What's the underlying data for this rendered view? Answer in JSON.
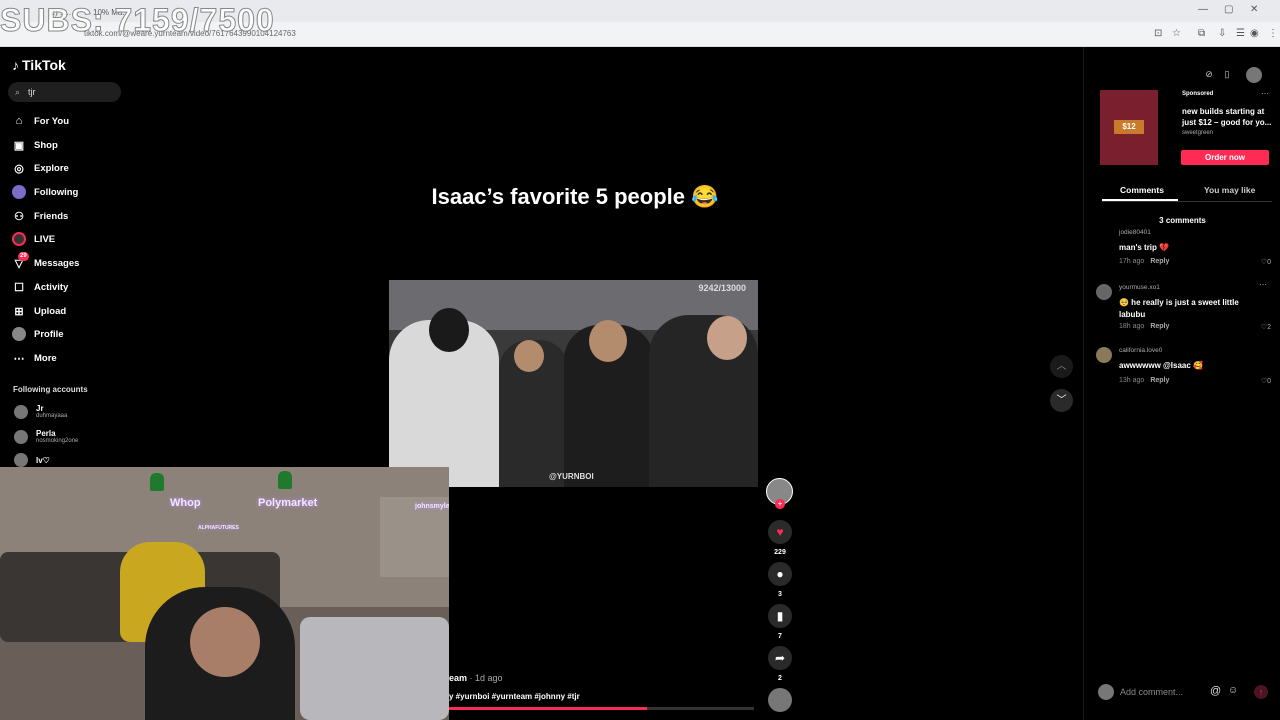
{
  "browser": {
    "tabs": [
      "(2) 1...",
      "10% Ma..."
    ],
    "url": "tiktok.com/@weare.yurnteam/video/7617643990104124763",
    "window_controls": [
      "—",
      "▢",
      "✕"
    ]
  },
  "overlay": {
    "subs_text": "SUBS: 7159/7500"
  },
  "sidebar": {
    "logo": "TikTok",
    "search_value": "tjr",
    "nav": [
      {
        "label": "For You",
        "icon": "home-icon"
      },
      {
        "label": "Shop",
        "icon": "shop-icon"
      },
      {
        "label": "Explore",
        "icon": "compass-icon"
      },
      {
        "label": "Following",
        "icon": "following-icon"
      },
      {
        "label": "Friends",
        "icon": "friends-icon"
      },
      {
        "label": "LIVE",
        "icon": "live-icon"
      },
      {
        "label": "Messages",
        "icon": "messages-icon",
        "badge": "29"
      },
      {
        "label": "Activity",
        "icon": "activity-icon"
      },
      {
        "label": "Upload",
        "icon": "upload-icon"
      },
      {
        "label": "Profile",
        "icon": "profile-icon"
      },
      {
        "label": "More",
        "icon": "more-icon"
      }
    ],
    "following_title": "Following accounts",
    "accounts": [
      {
        "name": "Jr",
        "username": "duhmayaaa"
      },
      {
        "name": "Perla",
        "username": "nosmoking2one"
      },
      {
        "name": "lv♡",
        "username": ""
      }
    ]
  },
  "video": {
    "title": "Isaac’s favorite 5 people 😂",
    "counter": "9242/13000",
    "watermark": "@YURNBOI",
    "author": "eam",
    "date": "· 1d ago",
    "tags": "y #yurnboi #yurnteam #johnny #tjr",
    "progress_fraction": 0.65
  },
  "actions": {
    "likes": "229",
    "comments": "3",
    "saves": "7",
    "shares": "2"
  },
  "ad": {
    "sponsored": "Sponsored",
    "text": "new builds starting at just $12 – good for yo...",
    "brand": "sweetgreen",
    "price": "$12",
    "cta": "Order now"
  },
  "panel": {
    "tabs": [
      "Comments",
      "You may like"
    ],
    "comment_count": "3 comments",
    "reply_label": "Reply"
  },
  "comments": [
    {
      "user": "jodie80401",
      "text": "man's trip 💔",
      "time": "17h ago",
      "likes": "0"
    },
    {
      "user": "yourmuse.xo1",
      "text": "🥺 he really is just a sweet little labubu",
      "time": "18h ago",
      "likes": "2"
    },
    {
      "user": "california.love0",
      "text": "awwwwww @Isaac 🥰",
      "time": "13h ago",
      "likes": "0"
    }
  ],
  "comment_bar": {
    "placeholder": "Add comment..."
  },
  "webcam": {
    "neon_left": "Whop",
    "neon_right": "Polymarket",
    "neon_center": "ALPHAFUTURES",
    "neon_side": "johnsmyle"
  },
  "colors": {
    "accent": "#fe2c55",
    "background": "#000000",
    "browser_chrome": "#f1f3f4"
  }
}
